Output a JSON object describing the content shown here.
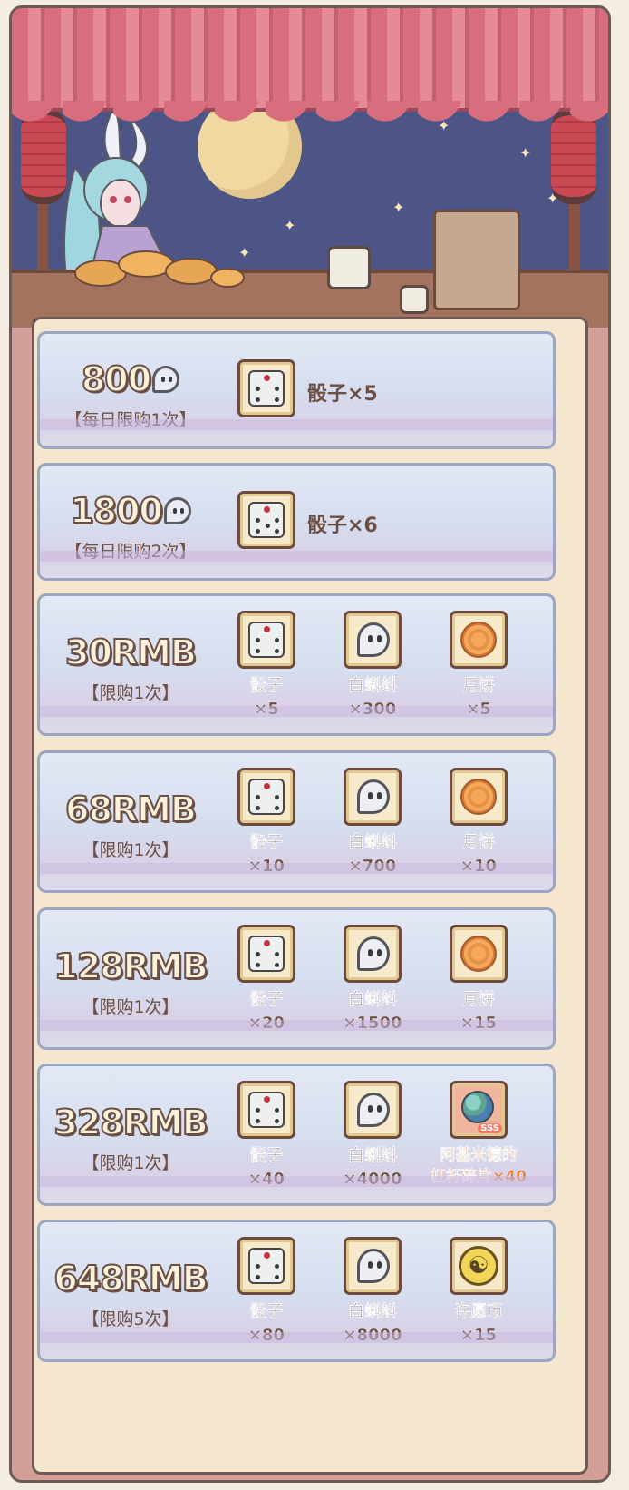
{
  "colors": {
    "price_text": "#fbf2dc",
    "price_outline": "#6b4f45",
    "label_text": "#6b4f45",
    "highlight_label": "#e5803a",
    "card_bg": "#d7dfef",
    "panel_bg": "#f4e6cf"
  },
  "icons": {
    "dice": "dice-icon",
    "tadpole": "white-tadpole-icon",
    "mooncake": "mooncake-icon",
    "lever_fragment": "archimedes-lever-fragment-icon",
    "coin": "wish-coin-icon"
  },
  "packs": [
    {
      "price": "800",
      "limit": "【每日限购1次】",
      "single_label": "骰子×5"
    },
    {
      "price": "1800",
      "limit": "【每日限购2次】",
      "single_label": "骰子×6"
    },
    {
      "price": "30RMB",
      "limit": "【限购1次】",
      "items": [
        {
          "name": "骰子",
          "qty": "×5"
        },
        {
          "name": "白蝌蚪",
          "qty": "×300"
        },
        {
          "name": "月饼",
          "qty": "×5"
        }
      ]
    },
    {
      "price": "68RMB",
      "limit": "【限购1次】",
      "items": [
        {
          "name": "骰子",
          "qty": "×10"
        },
        {
          "name": "白蝌蚪",
          "qty": "×700"
        },
        {
          "name": "月饼",
          "qty": "×10"
        }
      ]
    },
    {
      "price": "128RMB",
      "limit": "【限购1次】",
      "items": [
        {
          "name": "骰子",
          "qty": "×20"
        },
        {
          "name": "白蝌蚪",
          "qty": "×1500"
        },
        {
          "name": "月饼",
          "qty": "×15"
        }
      ]
    },
    {
      "price": "328RMB",
      "limit": "【限购1次】",
      "items": [
        {
          "name": "骰子",
          "qty": "×40"
        },
        {
          "name": "白蝌蚪",
          "qty": "×4000"
        },
        {
          "name": "阿基米德的",
          "qty": "杠杆碎片×40"
        }
      ]
    },
    {
      "price": "648RMB",
      "limit": "【限购5次】",
      "items": [
        {
          "name": "骰子",
          "qty": "×80"
        },
        {
          "name": "白蝌蚪",
          "qty": "×8000"
        },
        {
          "name": "许愿币",
          "qty": "×15"
        }
      ]
    }
  ]
}
